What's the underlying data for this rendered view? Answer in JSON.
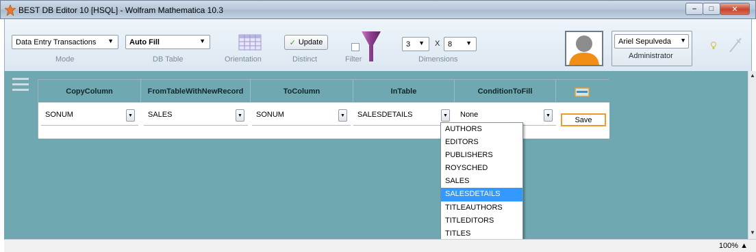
{
  "window": {
    "title": "BEST DB Editor 10 [HSQL] - Wolfram Mathematica 10.3",
    "buttons": [
      "minimize",
      "maximize",
      "close"
    ]
  },
  "toolbar": {
    "mode": {
      "value": "Data Entry Transactions",
      "label": "Mode"
    },
    "db_table": {
      "value": "Auto Fill",
      "label": "DB Table"
    },
    "orientation_label": "Orientation",
    "update_button": "Update",
    "distinct_label": "Distinct",
    "filter_label": "Filter",
    "dimensions": {
      "rows": "3",
      "x": "X",
      "cols": "8",
      "label": "Dimensions"
    },
    "user": {
      "name": "Ariel Sepulveda",
      "role": "Administrator"
    }
  },
  "grid": {
    "headers": [
      "CopyColumn",
      "FromTableWithNewRecord",
      "ToColumn",
      "InTable",
      "ConditionToFill"
    ],
    "row": [
      "SONUM",
      "SALES",
      "SONUM",
      "SALESDETAILS",
      "None"
    ],
    "save_button": "Save"
  },
  "dropdown_list": {
    "options": [
      "AUTHORS",
      "EDITORS",
      "PUBLISHERS",
      "ROYSCHED",
      "SALES",
      "SALESDETAILS",
      "TITLEAUTHORS",
      "TITLEDITORS",
      "TITLES"
    ],
    "selected": "SALESDETAILS"
  },
  "statusbar": {
    "zoom": "100%"
  },
  "colors": {
    "accent": "#6fa8b1",
    "selection": "#3399ff",
    "save_border": "#f09a2c"
  }
}
